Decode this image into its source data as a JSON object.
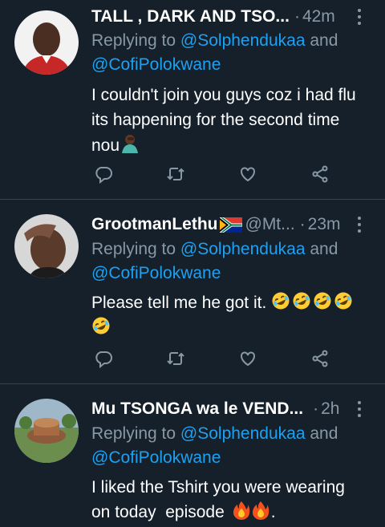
{
  "tweets": [
    {
      "name": "TALL , DARK AND TSO...",
      "handle": "",
      "time": "42m",
      "replying_prefix": "Replying to ",
      "mention1": "@Solphendukaa",
      "and_word": " and",
      "mention2": "@CofiPolokwane",
      "text_line1": "I couldn't join you guys coz i had flu",
      "text_line2": "its happening for the second time",
      "text_line3": "nou",
      "avatar_desc": "man-in-red-shirt"
    },
    {
      "name": "GrootmanLethu",
      "flag": "south-africa-flag",
      "handle": "@Mt...",
      "time": "23m",
      "replying_prefix": "Replying to ",
      "mention1": "@Solphendukaa",
      "and_word": " and",
      "mention2": "@CofiPolokwane",
      "text_line1": "Please tell me he got it.",
      "emoji": "rolling-on-floor-laughing",
      "avatar_desc": "man-selfie"
    },
    {
      "name": "Mu TSONGA wa le VEND...",
      "handle": "",
      "time": "2h",
      "replying_prefix": "Replying to ",
      "mention1": "@Solphendukaa",
      "and_word": " and",
      "mention2": "@CofiPolokwane",
      "text_line1": "I liked the Tshirt you were wearing",
      "text_line2": "on today  episode",
      "text_end": ".",
      "emoji": "fire",
      "avatar_desc": "monument-landscape"
    }
  ],
  "colors": {
    "background": "#15202b",
    "secondary": "#8899a6",
    "mention": "#1da1f2",
    "divider": "#38444d"
  },
  "icons": [
    "reply-icon",
    "retweet-icon",
    "like-icon",
    "share-icon",
    "more-options-icon"
  ]
}
